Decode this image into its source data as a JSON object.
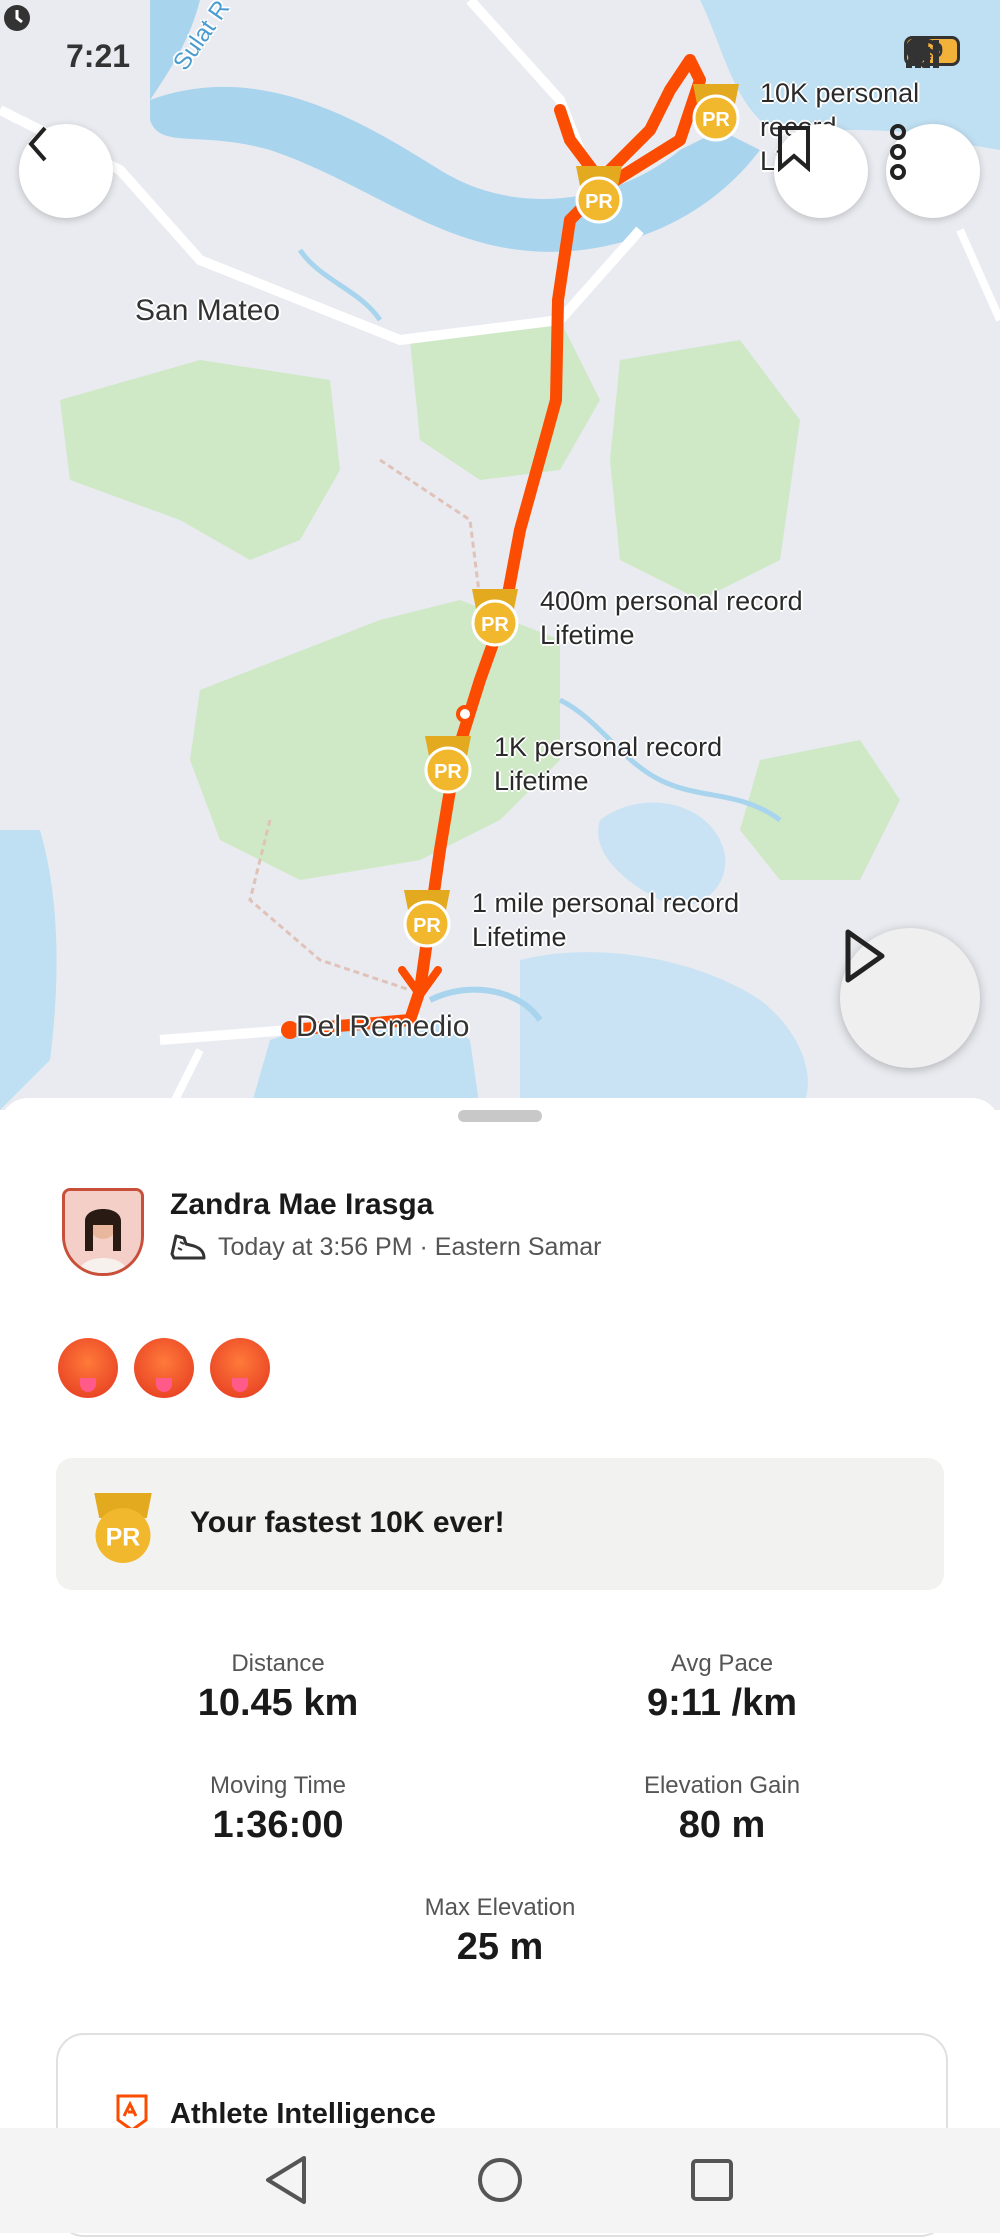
{
  "status_bar": {
    "time": "7:21",
    "battery": "19"
  },
  "map": {
    "places": {
      "top_river": "Sulat R",
      "san_mateo": "San Mateo",
      "del_remedio": "Del Remedio"
    },
    "pr_markers": [
      {
        "title": "10K personal record",
        "subtitle": "Lifetime"
      },
      {
        "title": "400m personal record",
        "subtitle": "Lifetime"
      },
      {
        "title": "1K personal record",
        "subtitle": "Lifetime"
      },
      {
        "title": "1 mile personal record",
        "subtitle": "Lifetime"
      }
    ],
    "badge_text": "PR"
  },
  "activity": {
    "athlete_name": "Zandra Mae Irasga",
    "meta": "Today at 3:56 PM · Eastern Samar",
    "pr_banner": "Your fastest 10K ever!",
    "stats": [
      {
        "label": "Distance",
        "value": "10.45 km"
      },
      {
        "label": "Avg Pace",
        "value": "9:11 /km"
      },
      {
        "label": "Moving Time",
        "value": "1:36:00"
      },
      {
        "label": "Elevation Gain",
        "value": "80 m"
      },
      {
        "label": "Max Elevation",
        "value": "25 m"
      }
    ],
    "athlete_intelligence": "Athlete Intelligence"
  },
  "colors": {
    "route": "#fc4c02",
    "water": "#a8d4ee",
    "park": "#cfe8c6",
    "pr_gold": "#f1b82d"
  }
}
